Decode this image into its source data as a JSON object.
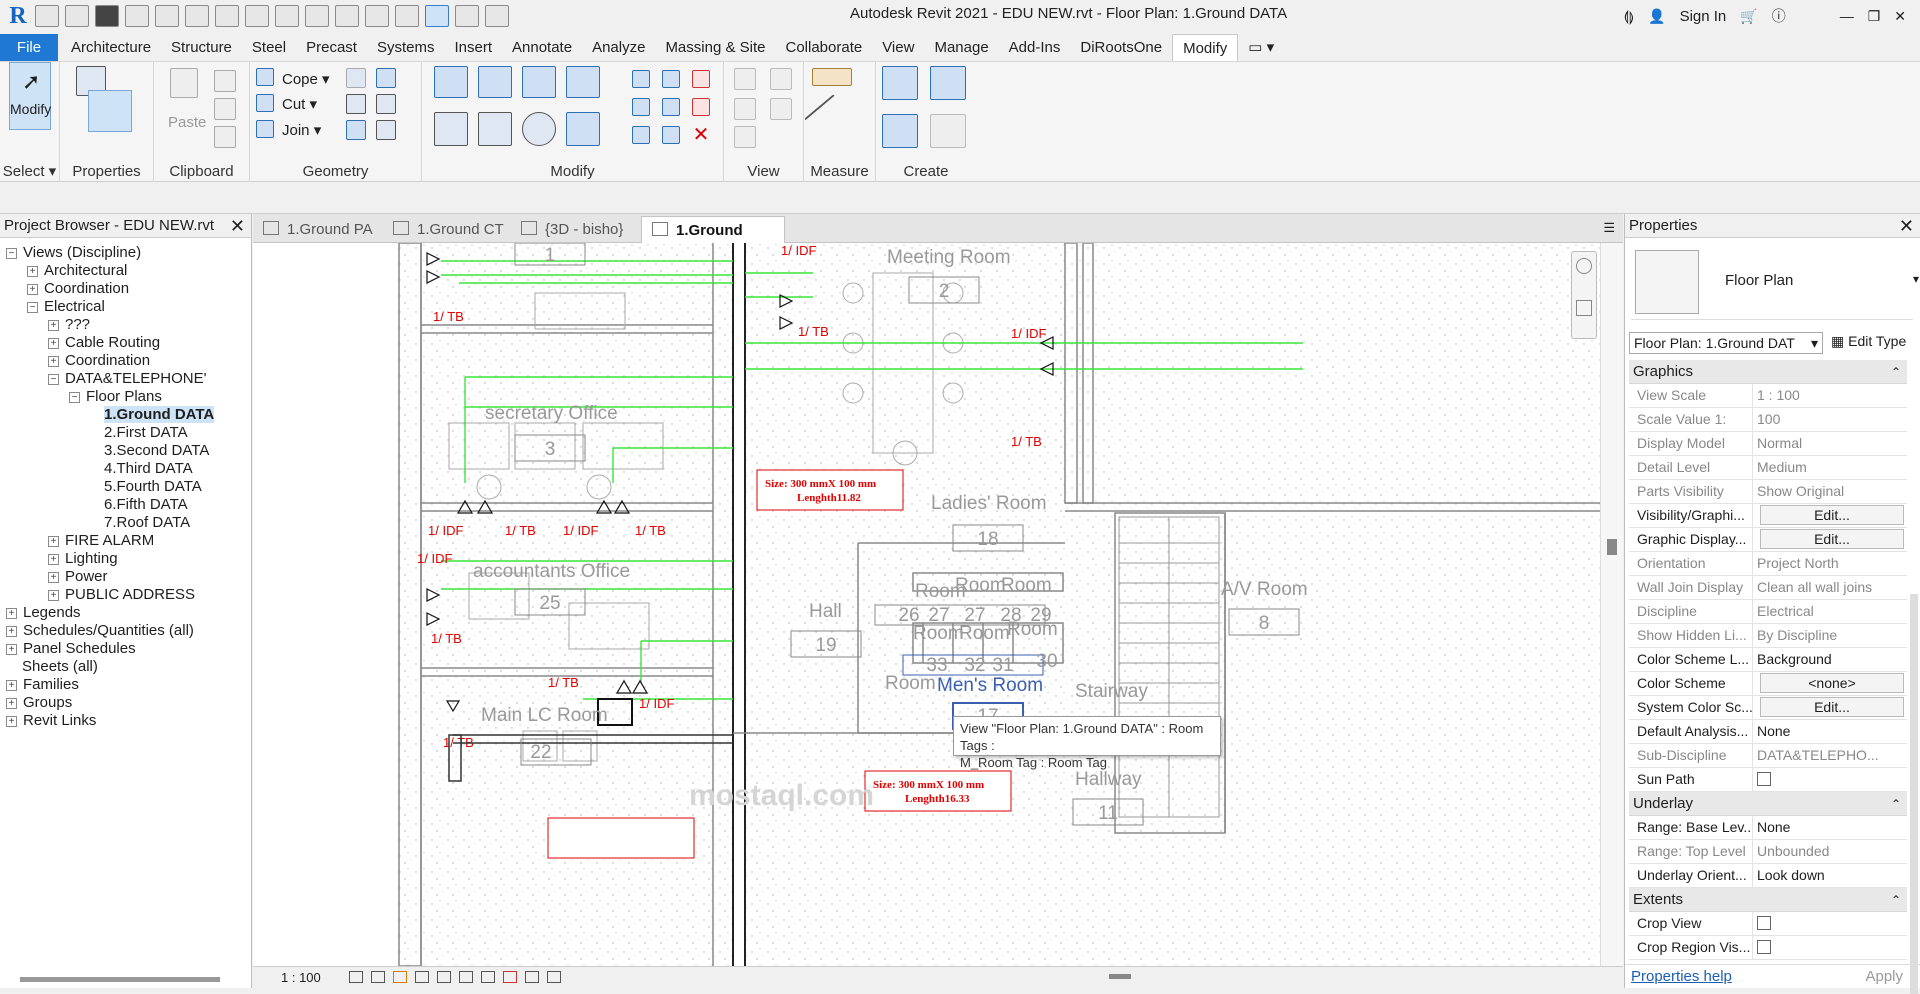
{
  "app": {
    "title": "Autodesk Revit 2021 - EDU NEW.rvt - Floor Plan: 1.Ground DATA",
    "sign_in": "Sign In",
    "logo": "R"
  },
  "menu": {
    "tabs": [
      "File",
      "Architecture",
      "Structure",
      "Steel",
      "Precast",
      "Systems",
      "Insert",
      "Annotate",
      "Analyze",
      "Massing & Site",
      "Collaborate",
      "View",
      "Manage",
      "Add-Ins",
      "DiRootsOne",
      "Modify"
    ]
  },
  "ribbon": {
    "modify_label": "Modify",
    "panels": [
      "Select",
      "Properties",
      "Clipboard",
      "Geometry",
      "Modify",
      "View",
      "Measure",
      "Create"
    ],
    "paste_label": "Paste",
    "cope_label": "Cope",
    "cut_label": "Cut",
    "join_label": "Join"
  },
  "project_browser": {
    "title": "Project Browser - EDU NEW.rvt",
    "items": [
      {
        "label": "Views (Discipline)",
        "level": 0,
        "box": "−"
      },
      {
        "label": "Architectural",
        "level": 1,
        "box": "+"
      },
      {
        "label": "Coordination",
        "level": 1,
        "box": "+"
      },
      {
        "label": "Electrical",
        "level": 1,
        "box": "−"
      },
      {
        "label": "???",
        "level": 2,
        "box": "+"
      },
      {
        "label": "Cable Routing",
        "level": 2,
        "box": "+"
      },
      {
        "label": "Coordination",
        "level": 2,
        "box": "+"
      },
      {
        "label": "DATA&TELEPHONE'",
        "level": 2,
        "box": "−"
      },
      {
        "label": "Floor Plans",
        "level": 3,
        "box": "−"
      },
      {
        "label": "1.Ground DATA",
        "level": 4,
        "box": "",
        "selected": true
      },
      {
        "label": "2.First DATA",
        "level": 4,
        "box": ""
      },
      {
        "label": "3.Second DATA",
        "level": 4,
        "box": ""
      },
      {
        "label": "4.Third DATA",
        "level": 4,
        "box": ""
      },
      {
        "label": "5.Fourth DATA",
        "level": 4,
        "box": ""
      },
      {
        "label": "6.Fifth DATA",
        "level": 4,
        "box": ""
      },
      {
        "label": "7.Roof DATA",
        "level": 4,
        "box": ""
      },
      {
        "label": "FIRE ALARM",
        "level": 2,
        "box": "+"
      },
      {
        "label": "Lighting",
        "level": 2,
        "box": "+"
      },
      {
        "label": "Power",
        "level": 2,
        "box": "+"
      },
      {
        "label": "PUBLIC ADDRESS",
        "level": 2,
        "box": "+"
      },
      {
        "label": "Legends",
        "level": 0,
        "box": "+"
      },
      {
        "label": "Schedules/Quantities (all)",
        "level": 0,
        "box": "+"
      },
      {
        "label": "Panel Schedules",
        "level": 0,
        "box": "+"
      },
      {
        "label": "Sheets (all)",
        "level": 0,
        "box": ""
      },
      {
        "label": "Families",
        "level": 0,
        "box": "+"
      },
      {
        "label": "Groups",
        "level": 0,
        "box": "+"
      },
      {
        "label": "Revit Links",
        "level": 0,
        "box": "+"
      }
    ]
  },
  "view_tabs": [
    {
      "label": "1.Ground PA",
      "active": false
    },
    {
      "label": "1.Ground CT",
      "active": false
    },
    {
      "label": "{3D - bisho}",
      "active": false
    },
    {
      "label": "1.Ground DATA",
      "active": true
    }
  ],
  "drawing": {
    "rooms": [
      {
        "name": "Meeting Room",
        "number": "2"
      },
      {
        "name": "secretary Office",
        "number": "3"
      },
      {
        "name": "accountants Office",
        "number": "25"
      },
      {
        "name": "Main LC Room",
        "number": "22"
      },
      {
        "name": "Ladies' Room",
        "number": "18"
      },
      {
        "name": "Hall",
        "number": "19"
      },
      {
        "name": "A/V Room",
        "number": "8"
      },
      {
        "name": "Stairway",
        "number": ""
      },
      {
        "name": "Hallway",
        "number": "11"
      },
      {
        "name": "Men's Room",
        "number": "17"
      }
    ],
    "top_room_number": "1",
    "small_rooms": [
      "26",
      "27",
      "28",
      "29",
      "33",
      "32",
      "31",
      "30"
    ],
    "room_word": "Room",
    "tags": {
      "idf": "1/ IDF",
      "tb": "1/ TB"
    },
    "size_label_1": [
      "Size: 300 mmX 100 mm",
      "Lenghth11.82"
    ],
    "size_label_2": [
      "Size: 300 mmX 100 mm",
      "Lenghth16.33"
    ],
    "tooltip": [
      "View \"Floor Plan: 1.Ground DATA\" : Room Tags :",
      "M_Room Tag : Room Tag"
    ],
    "watermark": "mostaql.com",
    "wire_color": "#39e639",
    "tag_color": "#e00000"
  },
  "status": {
    "scale": "1 : 100"
  },
  "properties": {
    "title": "Properties",
    "type_name": "Floor Plan",
    "selector": "Floor Plan: 1.Ground DAT",
    "edit_type": "Edit Type",
    "groups": [
      {
        "name": "Graphics",
        "rows": [
          {
            "k": "View Scale",
            "v": "1 : 100",
            "ro": true
          },
          {
            "k": "Scale Value    1:",
            "v": "100",
            "ro": true
          },
          {
            "k": "Display Model",
            "v": "Normal",
            "ro": true
          },
          {
            "k": "Detail Level",
            "v": "Medium",
            "ro": true
          },
          {
            "k": "Parts Visibility",
            "v": "Show Original",
            "ro": true
          },
          {
            "k": "Visibility/Graphi...",
            "v": "Edit...",
            "btn": true
          },
          {
            "k": "Graphic Display...",
            "v": "Edit...",
            "btn": true
          },
          {
            "k": "Orientation",
            "v": "Project North",
            "ro": true
          },
          {
            "k": "Wall Join Display",
            "v": "Clean all wall joins",
            "ro": true
          },
          {
            "k": "Discipline",
            "v": "Electrical",
            "ro": true
          },
          {
            "k": "Show Hidden Li...",
            "v": "By Discipline",
            "ro": true
          },
          {
            "k": "Color Scheme L...",
            "v": "Background"
          },
          {
            "k": "Color Scheme",
            "v": "<none>",
            "btn": true
          },
          {
            "k": "System Color Sc...",
            "v": "Edit...",
            "btn": true
          },
          {
            "k": "Default Analysis...",
            "v": "None"
          },
          {
            "k": "Sub-Discipline",
            "v": "DATA&TELEPHO...",
            "ro": true
          },
          {
            "k": "Sun Path",
            "v": "",
            "chk": true
          }
        ]
      },
      {
        "name": "Underlay",
        "rows": [
          {
            "k": "Range: Base Lev...",
            "v": "None"
          },
          {
            "k": "Range: Top Level",
            "v": "Unbounded",
            "ro": true
          },
          {
            "k": "Underlay Orient...",
            "v": "Look down"
          }
        ]
      },
      {
        "name": "Extents",
        "rows": [
          {
            "k": "Crop View",
            "v": "",
            "chk": true
          },
          {
            "k": "Crop Region Vis...",
            "v": "",
            "chk": true
          }
        ]
      }
    ],
    "help": "Properties help",
    "apply": "Apply"
  }
}
